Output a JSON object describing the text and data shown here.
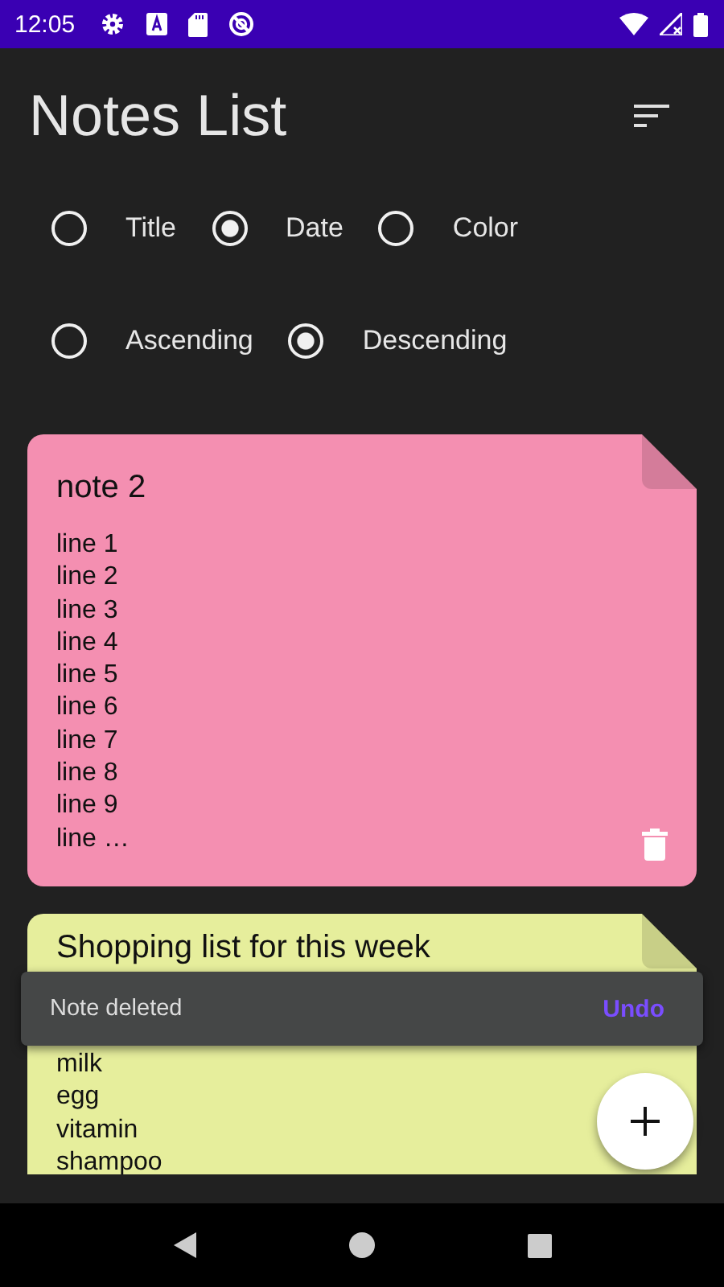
{
  "status_bar": {
    "time": "12:05"
  },
  "app_bar": {
    "title": "Notes List"
  },
  "sort_by": [
    {
      "label": "Title",
      "selected": false
    },
    {
      "label": "Date",
      "selected": true
    },
    {
      "label": "Color",
      "selected": false
    }
  ],
  "order": [
    {
      "label": "Ascending",
      "selected": false
    },
    {
      "label": "Descending",
      "selected": true
    }
  ],
  "notes": [
    {
      "title": "note 2",
      "color": "#f48fb1",
      "lines": [
        "line 1",
        "line 2",
        "line 3",
        "line 4",
        "line 5",
        "line 6",
        "line 7",
        "line 8",
        "line 9",
        "line …"
      ]
    },
    {
      "title": "Shopping list for this week",
      "color": "#e6ee9c",
      "lines": [
        "milk",
        "egg",
        "vitamin",
        "shampoo"
      ]
    }
  ],
  "snackbar": {
    "message": "Note deleted",
    "action": "Undo"
  }
}
